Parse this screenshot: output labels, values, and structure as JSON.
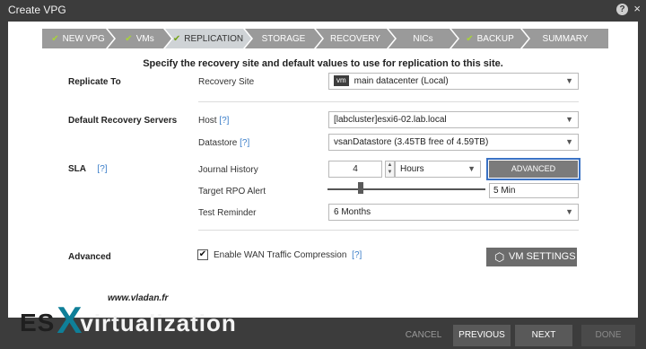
{
  "window": {
    "title": "Create VPG",
    "help_icon": "?",
    "close_icon": "×"
  },
  "steps": [
    {
      "label": "NEW VPG",
      "done": true
    },
    {
      "label": "VMs",
      "done": true
    },
    {
      "label": "REPLICATION",
      "done": true,
      "active": true
    },
    {
      "label": "STORAGE",
      "done": false
    },
    {
      "label": "RECOVERY",
      "done": false
    },
    {
      "label": "NICs",
      "done": false
    },
    {
      "label": "BACKUP",
      "done": true
    },
    {
      "label": "SUMMARY",
      "done": false
    }
  ],
  "heading": "Specify the recovery site and default values to use for replication to this site.",
  "replicate_to": {
    "section_label": "Replicate To",
    "field_label": "Recovery Site",
    "badge": "vm",
    "value": "main datacenter (Local)"
  },
  "default_servers": {
    "section_label": "Default Recovery Servers",
    "host_label": "Host",
    "host_help": "[?]",
    "host_value": "[labcluster]esxi6-02.lab.local",
    "datastore_label": "Datastore",
    "datastore_help": "[?]",
    "datastore_value": "vsanDatastore (3.45TB free of 4.59TB)"
  },
  "sla": {
    "section_label": "SLA",
    "help": "[?]",
    "journal_label": "Journal History",
    "journal_value": "4",
    "journal_unit": "Hours",
    "advanced_button": "ADVANCED",
    "rpo_label": "Target RPO Alert",
    "rpo_value": "5 Min",
    "test_label": "Test Reminder",
    "test_value": "6 Months"
  },
  "advanced": {
    "section_label": "Advanced",
    "wan_checked": true,
    "wan_label": "Enable WAN Traffic Compression",
    "wan_help": "[?]",
    "vm_settings_button": "VM SETTINGS"
  },
  "watermark": {
    "url": "www.vladan.fr",
    "es": "ES",
    "x": "X",
    "virtualization": "virtualization"
  },
  "footer": {
    "cancel": "CANCEL",
    "previous": "PREVIOUS",
    "next": "NEXT",
    "done": "DONE"
  },
  "colors": {
    "accent_blue": "#3a72c4",
    "check_green": "#a8d33a",
    "logo_teal": "#0f7f98"
  }
}
